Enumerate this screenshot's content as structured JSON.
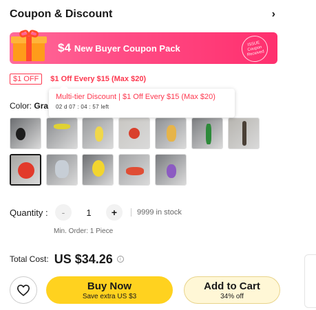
{
  "coupon": {
    "title": "Coupon & Discount",
    "banner_amount": "$4",
    "banner_label": "New Buyer Coupon Pack",
    "stamp_line1": "ISSUE",
    "stamp_line2": "Coupon",
    "stamp_line3": "Received"
  },
  "discount": {
    "badge": "$1 OFF",
    "text": "$1 Off Every $15  (Max $20)"
  },
  "tooltip": {
    "title": "Multi-tier Discount  |  $1 Off Every $15  (Max $20)",
    "countdown": "02 d   07 : 04 : 57  left"
  },
  "color": {
    "label": "Color:",
    "value": "Gra"
  },
  "thumbnails": [
    {
      "name": "thumb-1",
      "bg": "#6b6d70",
      "obj": "#1d1d1d"
    },
    {
      "name": "thumb-2",
      "bg": "#8a8c8f",
      "obj": "#e0d233"
    },
    {
      "name": "thumb-3",
      "bg": "#9a9c9e",
      "obj": "#f0d74a"
    },
    {
      "name": "thumb-4",
      "bg": "#c9c7c3",
      "obj": "#d9402c"
    },
    {
      "name": "thumb-5",
      "bg": "#8f9194",
      "obj": "#e6b44a"
    },
    {
      "name": "thumb-6",
      "bg": "#7d7f82",
      "obj": "#2d8a3a"
    },
    {
      "name": "thumb-7",
      "bg": "#b7b5b0",
      "obj": "#4a4036"
    },
    {
      "name": "thumb-8",
      "bg": "#a7a6a3",
      "obj": "#e23a2b"
    },
    {
      "name": "thumb-9",
      "bg": "#8c8e91",
      "obj": "#c7ced6"
    },
    {
      "name": "thumb-10",
      "bg": "#6e7073",
      "obj": "#f2d52e"
    },
    {
      "name": "thumb-11",
      "bg": "#a3a4a6",
      "obj": "#e04d34"
    },
    {
      "name": "thumb-12",
      "bg": "#7a7c80",
      "obj": "#8c5bc2"
    }
  ],
  "quantity": {
    "label": "Quantity :",
    "minus": "-",
    "value": "1",
    "plus": "+",
    "stock": "9999 in stock",
    "min_order": "Min. Order: 1 Piece"
  },
  "total": {
    "label": "Total Cost:",
    "value": "US $34.26",
    "info": "i"
  },
  "actions": {
    "buy_label": "Buy Now",
    "buy_sub": "Save extra US $3",
    "cart_label": "Add to Cart",
    "cart_sub": "34% off"
  },
  "colors": {
    "accent_red": "#fd384f",
    "buy_yellow": "#ffd21f",
    "cart_bg": "#fff7d6"
  }
}
